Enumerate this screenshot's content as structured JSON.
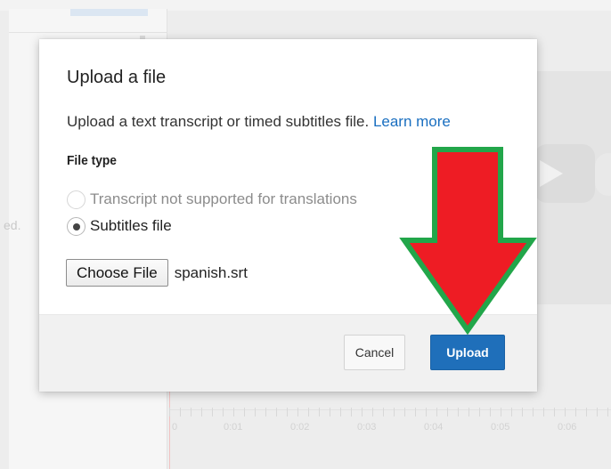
{
  "background": {
    "cut_text": "ed.",
    "timeline_labels": [
      "0",
      "0:01",
      "0:02",
      "0:03",
      "0:04",
      "0:05",
      "0:06"
    ]
  },
  "dialog": {
    "title": "Upload a file",
    "description": "Upload a text transcript or timed subtitles file.",
    "learn_more": "Learn more",
    "file_type_label": "File type",
    "options": [
      {
        "label": "Transcript not supported for translations",
        "checked": false,
        "disabled": true
      },
      {
        "label": "Subtitles file",
        "checked": true,
        "disabled": false
      }
    ],
    "choose_file_label": "Choose File",
    "file_name": "spanish.srt",
    "cancel_label": "Cancel",
    "upload_label": "Upload"
  },
  "colors": {
    "accent": "#1f6fba",
    "link": "#1a6fc0",
    "arrow_fill": "#ee1c24",
    "arrow_outline": "#22a64a"
  },
  "icons": {
    "annotation": "down-arrow-icon",
    "video": "play-icon"
  }
}
